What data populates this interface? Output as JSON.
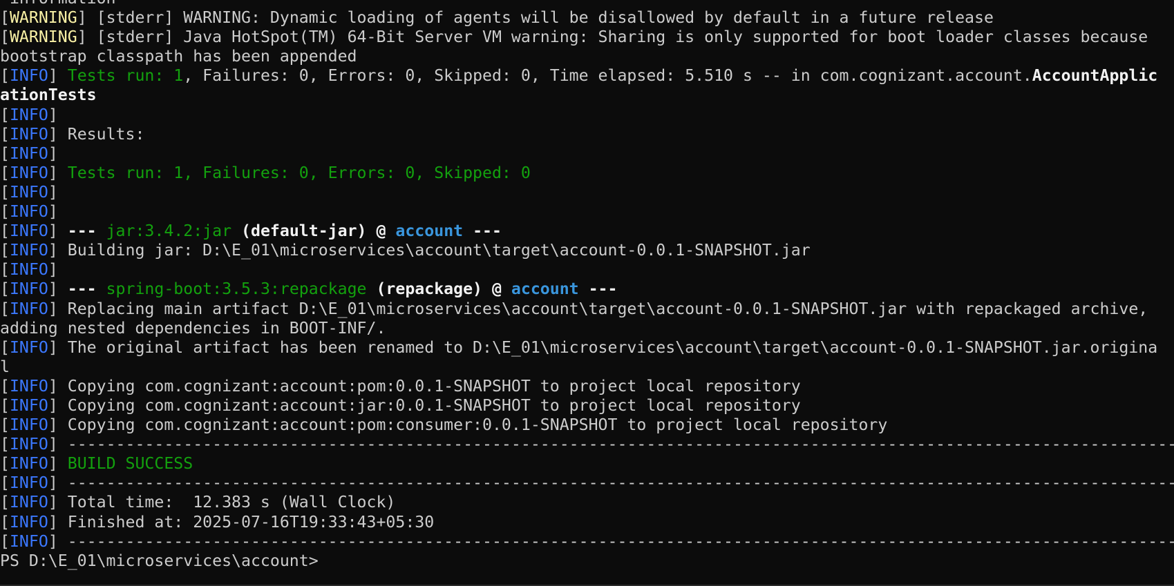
{
  "lines": [
    [
      {
        "t": " information",
        "c": "default"
      }
    ],
    [
      {
        "t": "[",
        "c": "default"
      },
      {
        "t": "WARNING",
        "c": "yellow"
      },
      {
        "t": "] [stderr] WARNING: Dynamic loading of agents will be disallowed by default in a future release",
        "c": "default"
      }
    ],
    [
      {
        "t": "[",
        "c": "default"
      },
      {
        "t": "WARNING",
        "c": "yellow"
      },
      {
        "t": "] [stderr] Java HotSpot(TM) 64-Bit Server VM warning: Sharing is only supported for boot loader classes because",
        "c": "default"
      }
    ],
    [
      {
        "t": "bootstrap classpath has been appended",
        "c": "default"
      }
    ],
    [
      {
        "t": "[",
        "c": "default"
      },
      {
        "t": "INFO",
        "c": "blue"
      },
      {
        "t": "] ",
        "c": "default"
      },
      {
        "t": "Tests run: ",
        "c": "green"
      },
      {
        "t": "1",
        "c": "green"
      },
      {
        "t": ", Failures: 0, Errors: 0, Skipped: 0, Time elapsed: 5.510 s -- in com.cognizant.account.",
        "c": "default"
      },
      {
        "t": "AccountApplic",
        "c": "bold"
      }
    ],
    [
      {
        "t": "ationTests",
        "c": "bold"
      }
    ],
    [
      {
        "t": "[",
        "c": "default"
      },
      {
        "t": "INFO",
        "c": "blue"
      },
      {
        "t": "]",
        "c": "default"
      }
    ],
    [
      {
        "t": "[",
        "c": "default"
      },
      {
        "t": "INFO",
        "c": "blue"
      },
      {
        "t": "] Results:",
        "c": "default"
      }
    ],
    [
      {
        "t": "[",
        "c": "default"
      },
      {
        "t": "INFO",
        "c": "blue"
      },
      {
        "t": "]",
        "c": "default"
      }
    ],
    [
      {
        "t": "[",
        "c": "default"
      },
      {
        "t": "INFO",
        "c": "blue"
      },
      {
        "t": "] ",
        "c": "default"
      },
      {
        "t": "Tests run: 1, Failures: 0, Errors: 0, Skipped: 0",
        "c": "green"
      }
    ],
    [
      {
        "t": "[",
        "c": "default"
      },
      {
        "t": "INFO",
        "c": "blue"
      },
      {
        "t": "]",
        "c": "default"
      }
    ],
    [
      {
        "t": "[",
        "c": "default"
      },
      {
        "t": "INFO",
        "c": "blue"
      },
      {
        "t": "]",
        "c": "default"
      }
    ],
    [
      {
        "t": "[",
        "c": "default"
      },
      {
        "t": "INFO",
        "c": "blue"
      },
      {
        "t": "] ",
        "c": "default"
      },
      {
        "t": "--- ",
        "c": "bold"
      },
      {
        "t": "jar:3.4.2:jar",
        "c": "green"
      },
      {
        "t": " (default-jar) @ ",
        "c": "bold"
      },
      {
        "t": "account",
        "c": "blue-bold"
      },
      {
        "t": " ---",
        "c": "bold"
      }
    ],
    [
      {
        "t": "[",
        "c": "default"
      },
      {
        "t": "INFO",
        "c": "blue"
      },
      {
        "t": "] Building jar: D:\\E_01\\microservices\\account\\target\\account-0.0.1-SNAPSHOT.jar",
        "c": "default"
      }
    ],
    [
      {
        "t": "[",
        "c": "default"
      },
      {
        "t": "INFO",
        "c": "blue"
      },
      {
        "t": "]",
        "c": "default"
      }
    ],
    [
      {
        "t": "[",
        "c": "default"
      },
      {
        "t": "INFO",
        "c": "blue"
      },
      {
        "t": "] ",
        "c": "default"
      },
      {
        "t": "--- ",
        "c": "bold"
      },
      {
        "t": "spring-boot:3.5.3:repackage",
        "c": "green"
      },
      {
        "t": " (repackage) @ ",
        "c": "bold"
      },
      {
        "t": "account",
        "c": "blue-bold"
      },
      {
        "t": " ---",
        "c": "bold"
      }
    ],
    [
      {
        "t": "[",
        "c": "default"
      },
      {
        "t": "INFO",
        "c": "blue"
      },
      {
        "t": "] Replacing main artifact D:\\E_01\\microservices\\account\\target\\account-0.0.1-SNAPSHOT.jar with repackaged archive,",
        "c": "default"
      }
    ],
    [
      {
        "t": "adding nested dependencies in BOOT-INF/.",
        "c": "default"
      }
    ],
    [
      {
        "t": "[",
        "c": "default"
      },
      {
        "t": "INFO",
        "c": "blue"
      },
      {
        "t": "] The original artifact has been renamed to D:\\E_01\\microservices\\account\\target\\account-0.0.1-SNAPSHOT.jar.origina",
        "c": "default"
      }
    ],
    [
      {
        "t": "l",
        "c": "default"
      }
    ],
    [
      {
        "t": "[",
        "c": "default"
      },
      {
        "t": "INFO",
        "c": "blue"
      },
      {
        "t": "] Copying com.cognizant:account:pom:0.0.1-SNAPSHOT to project local repository",
        "c": "default"
      }
    ],
    [
      {
        "t": "[",
        "c": "default"
      },
      {
        "t": "INFO",
        "c": "blue"
      },
      {
        "t": "] Copying com.cognizant:account:jar:0.0.1-SNAPSHOT to project local repository",
        "c": "default"
      }
    ],
    [
      {
        "t": "[",
        "c": "default"
      },
      {
        "t": "INFO",
        "c": "blue"
      },
      {
        "t": "] Copying com.cognizant:account:pom:consumer:0.0.1-SNAPSHOT to project local repository",
        "c": "default"
      }
    ],
    [
      {
        "t": "[",
        "c": "default"
      },
      {
        "t": "INFO",
        "c": "blue"
      },
      {
        "t": "] ------------------------------------------------------------------------------------------------------------------------",
        "c": "default"
      }
    ],
    [
      {
        "t": "[",
        "c": "default"
      },
      {
        "t": "INFO",
        "c": "blue"
      },
      {
        "t": "] ",
        "c": "default"
      },
      {
        "t": "BUILD SUCCESS",
        "c": "green"
      }
    ],
    [
      {
        "t": "[",
        "c": "default"
      },
      {
        "t": "INFO",
        "c": "blue"
      },
      {
        "t": "] ------------------------------------------------------------------------------------------------------------------------",
        "c": "default"
      }
    ],
    [
      {
        "t": "[",
        "c": "default"
      },
      {
        "t": "INFO",
        "c": "blue"
      },
      {
        "t": "] Total time:  12.383 s (Wall Clock)",
        "c": "default"
      }
    ],
    [
      {
        "t": "[",
        "c": "default"
      },
      {
        "t": "INFO",
        "c": "blue"
      },
      {
        "t": "] Finished at: 2025-07-16T19:33:43+05:30",
        "c": "default"
      }
    ],
    [
      {
        "t": "[",
        "c": "default"
      },
      {
        "t": "INFO",
        "c": "blue"
      },
      {
        "t": "] ------------------------------------------------------------------------------------------------------------------------",
        "c": "default"
      }
    ],
    [
      {
        "t": "PS D:\\E_01\\microservices\\account>",
        "c": "default"
      }
    ]
  ],
  "colors": {
    "background": "#0c0c0c",
    "default": "#cccccc",
    "green": "#13a10e",
    "blue": "#3b78ff",
    "yellow": "#f9f1a5"
  }
}
